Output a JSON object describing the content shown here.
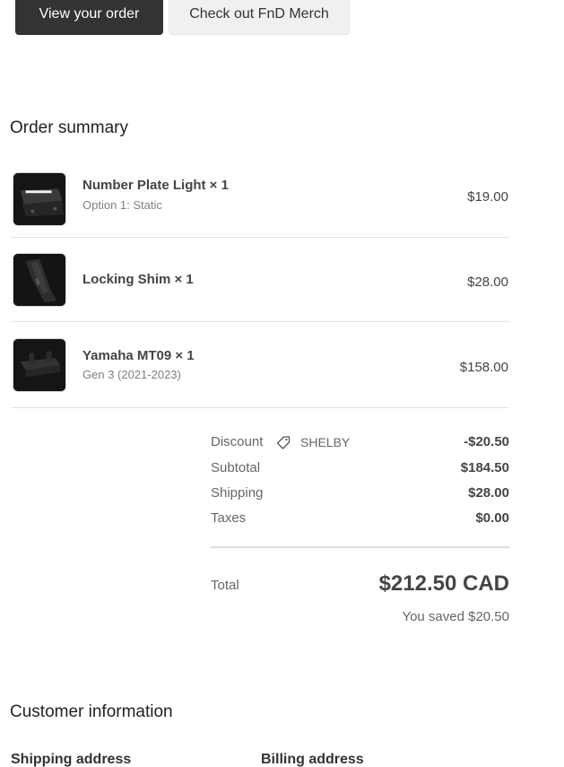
{
  "actions": {
    "view_order": "View your order",
    "merch": "Check out FnD Merch"
  },
  "order_summary": {
    "heading": "Order summary",
    "items": [
      {
        "title": "Number Plate Light × 1",
        "variant": "Option 1: Static",
        "price": "$19.00",
        "image_icon": "number-plate-light-image"
      },
      {
        "title": "Locking Shim × 1",
        "variant": "",
        "price": "$28.00",
        "image_icon": "locking-shim-image"
      },
      {
        "title": "Yamaha MT09 × 1",
        "variant": "Gen 3 (2021-2023)",
        "price": "$158.00",
        "image_icon": "yamaha-mount-image"
      }
    ],
    "discount": {
      "label": "Discount",
      "code": "SHELBY",
      "value": "-$20.50",
      "icon": "tag-icon"
    },
    "subtotal": {
      "label": "Subtotal",
      "value": "$184.50"
    },
    "shipping": {
      "label": "Shipping",
      "value": "$28.00"
    },
    "taxes": {
      "label": "Taxes",
      "value": "$0.00"
    },
    "total": {
      "label": "Total",
      "value": "$212.50 CAD"
    },
    "saved": "You saved $20.50"
  },
  "customer_info": {
    "heading": "Customer information",
    "shipping_address_label": "Shipping address",
    "billing_address_label": "Billing address"
  }
}
